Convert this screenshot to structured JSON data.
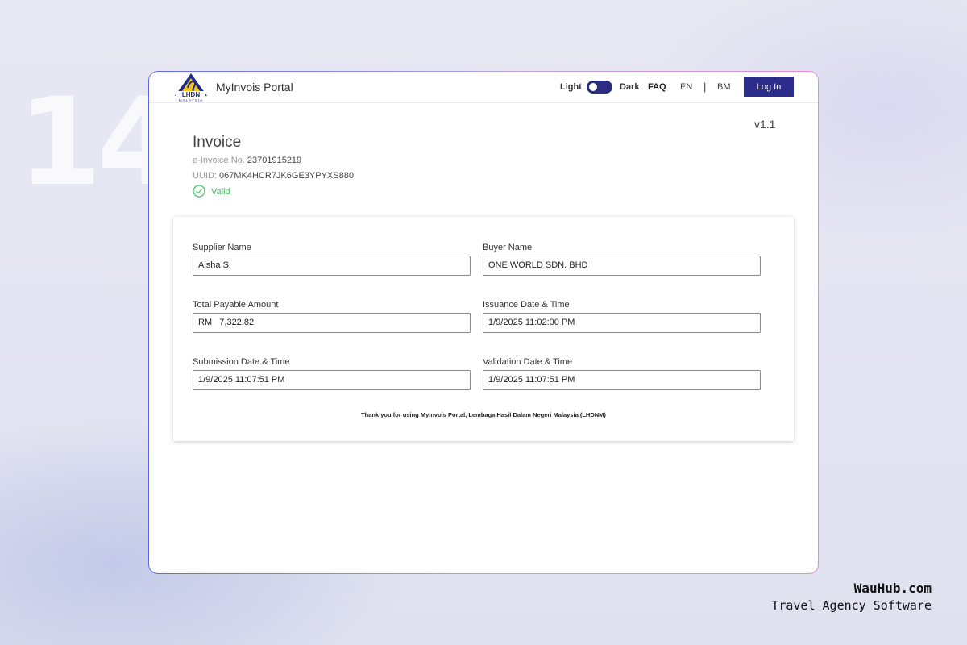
{
  "slide_number": "14",
  "header": {
    "logo_text": "LHDN",
    "logo_subtext": "MALAYSIA",
    "portal_title": "MyInvois Portal",
    "theme_light": "Light",
    "theme_dark": "Dark",
    "theme_toggle_state": "light",
    "faq_label": "FAQ",
    "lang_en": "EN",
    "lang_separator": "|",
    "lang_bm": "BM",
    "login_label": "Log In",
    "accent_color": "#2b2c8c"
  },
  "invoice": {
    "version": "v1.1",
    "title": "Invoice",
    "einvoice_label": "e-Invoice No.",
    "einvoice_no": "23701915219",
    "uuid_label": "UUID:",
    "uuid_value": "067MK4HCR7JK6GE3YPYXS880",
    "status": "Valid",
    "status_icon": "check-circle-icon",
    "status_color": "#3fc15e"
  },
  "fields": {
    "supplier_name_label": "Supplier Name",
    "supplier_name_value": "Aisha S.",
    "buyer_name_label": "Buyer Name",
    "buyer_name_value": "ONE WORLD SDN. BHD",
    "total_payable_label": "Total Payable Amount",
    "total_payable_value": "RM   7,322.82",
    "issuance_label": "Issuance Date & Time",
    "issuance_value": "1/9/2025 11:02:00 PM",
    "submission_label": "Submission Date & Time",
    "submission_value": "1/9/2025 11:07:51 PM",
    "validation_label": "Validation Date & Time",
    "validation_value": "1/9/2025 11:07:51 PM"
  },
  "footer_note": "Thank you for using MyInvois Portal, Lembaga Hasil Dalam Negeri Malaysia (LHDNM)",
  "branding": {
    "name": "WauHub.com",
    "tagline": "Travel Agency Software"
  }
}
